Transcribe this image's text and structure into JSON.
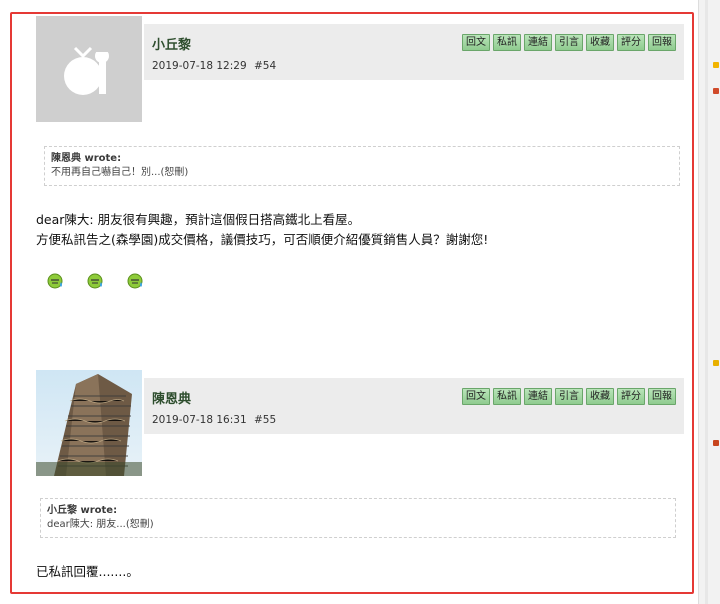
{
  "post54": {
    "author": "小丘黎",
    "datetime": "2019-07-18 12:29",
    "post_number": "#54",
    "actions": [
      "回文",
      "私訊",
      "連結",
      "引言",
      "收藏",
      "評分",
      "回報"
    ],
    "quote": {
      "header": "陳恩典 wrote:",
      "body": "不用再自己嚇自己！別...(恕刪)"
    },
    "body_lines": [
      "dear陳大: 朋友很有興趣，預計這個假日搭高鐵北上看屋。",
      "方便私訊告之(森學園)成交價格，議價技巧，可否順便介紹優質銷售人員？謝謝您!"
    ],
    "emoji_icons": [
      "sweat-smile-icon",
      "sweat-smile-icon",
      "sweat-smile-icon"
    ]
  },
  "post55": {
    "author": "陳恩典",
    "datetime": "2019-07-18 16:31",
    "post_number": "#55",
    "actions": [
      "回文",
      "私訊",
      "連結",
      "引言",
      "收藏",
      "評分",
      "回報"
    ],
    "quote": {
      "header": "小丘黎 wrote:",
      "body": "dear陳大: 朋友...(恕刪)"
    },
    "body_lines": [
      "已私訊回覆.......。"
    ]
  },
  "colors": {
    "frame_border": "#e53935",
    "action_button": "#9fd59f",
    "author_text": "#2e4e2e"
  }
}
